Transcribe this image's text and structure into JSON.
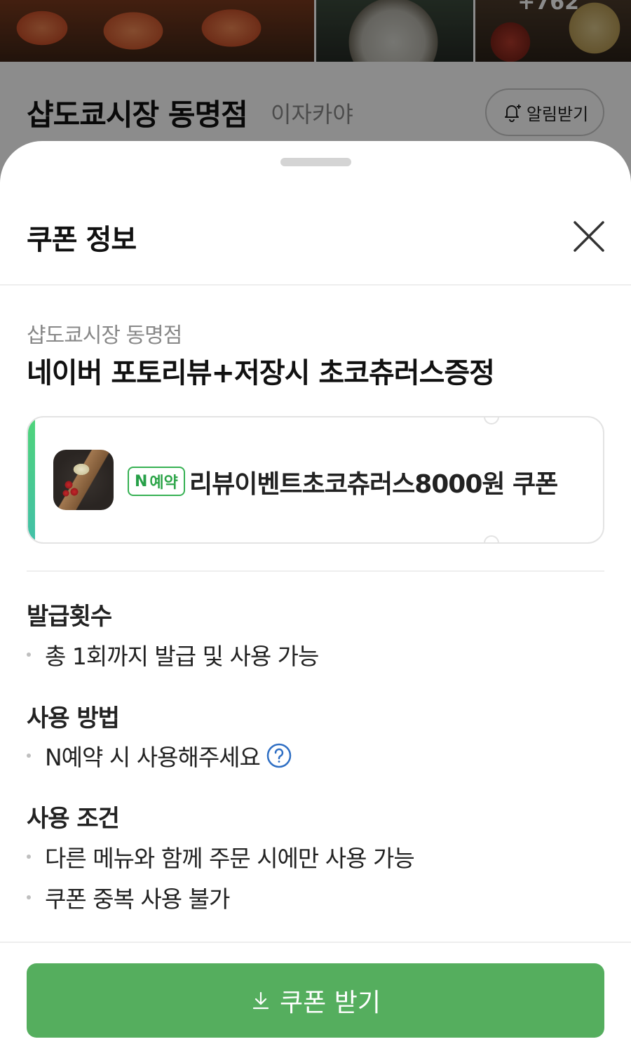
{
  "background": {
    "photo_more_count": "+762",
    "store_name": "샵도쿄시장 동명점",
    "store_category": "이자카야",
    "notify_label": "알림받기"
  },
  "sheet": {
    "title": "쿠폰 정보",
    "coupon": {
      "store": "샵도쿄시장 동명점",
      "title": "네이버 포토리뷰+저장시 초코츄러스증정",
      "badge_n": "N",
      "badge_label": "예약",
      "name": "리뷰이벤트초코츄러스8000원 쿠폰"
    },
    "sections": [
      {
        "title": "발급횟수",
        "items": [
          "총 1회까지 발급 및 사용 가능"
        ]
      },
      {
        "title": "사용 방법",
        "items": [
          "N예약 시 사용해주세요"
        ]
      },
      {
        "title": "사용 조건",
        "items": [
          "다른 메뉴와 함께 주문 시에만 사용 가능",
          "쿠폰 중복 사용 불가"
        ]
      }
    ],
    "download_label": "쿠폰 받기"
  },
  "colors": {
    "accent_green": "#55ae5e",
    "badge_green": "#2ea54a",
    "help_blue": "#2f6fc4"
  },
  "icons": [
    "bell-icon",
    "close-icon",
    "help-icon",
    "download-icon"
  ]
}
